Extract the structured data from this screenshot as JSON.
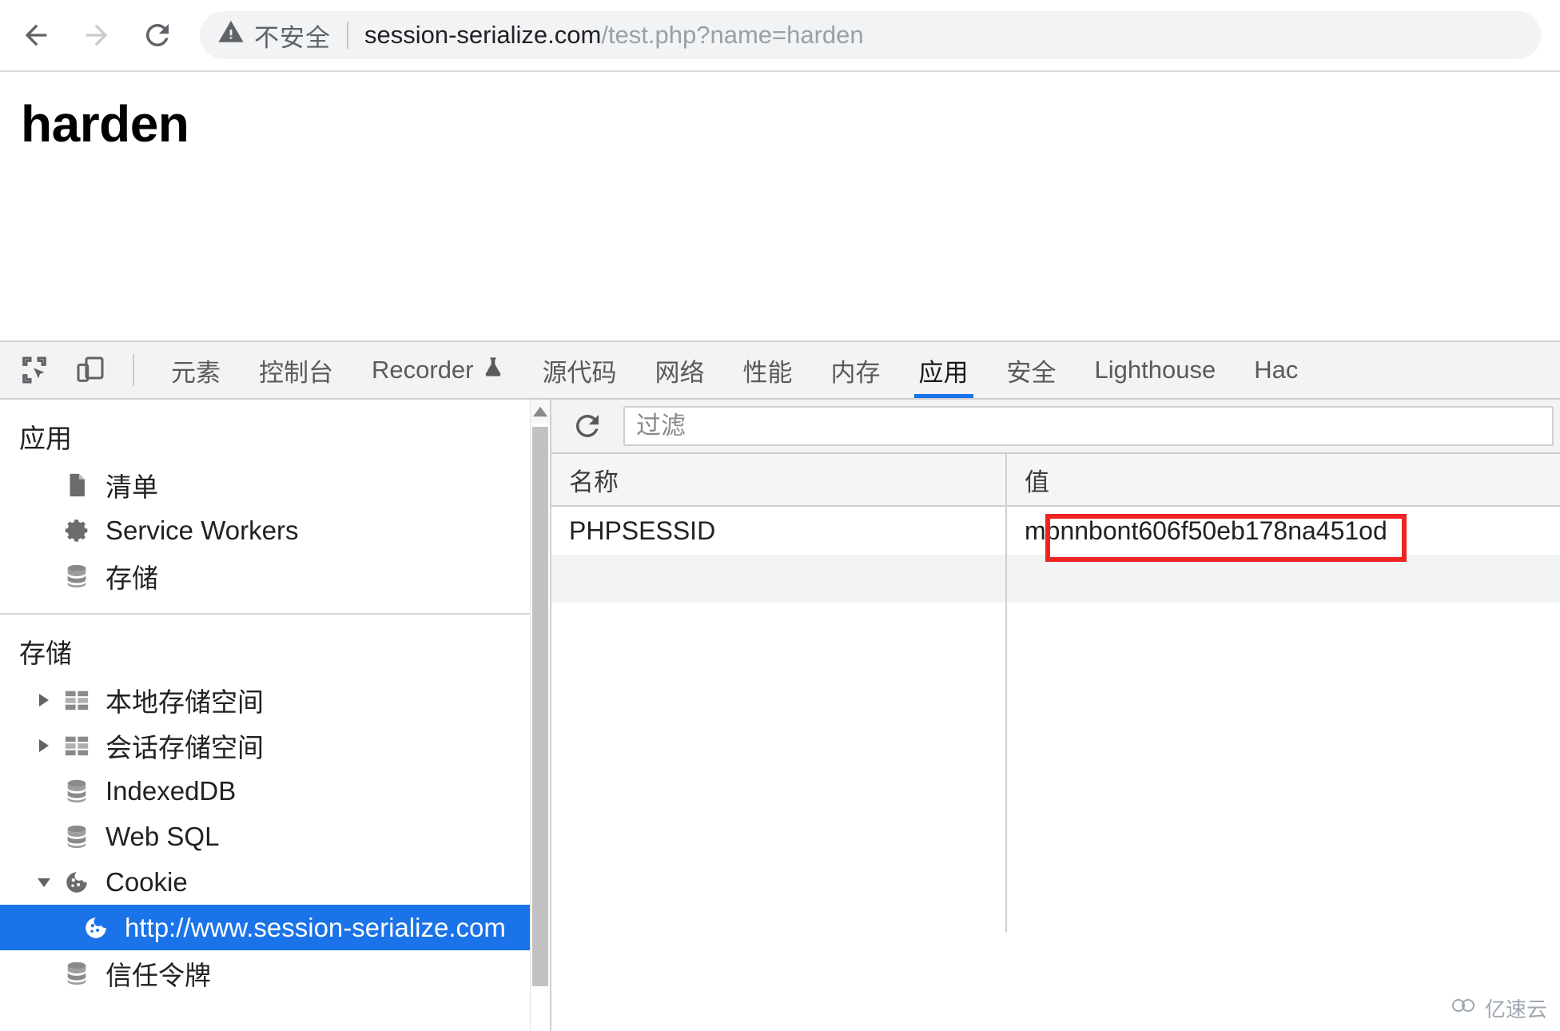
{
  "browser": {
    "back_label": "back-arrow",
    "forward_label": "forward-arrow",
    "reload_label": "reload",
    "security_text": "不安全",
    "url_host": "session-serialize.com",
    "url_path": "/test.php?name=harden"
  },
  "page": {
    "heading": "harden"
  },
  "devtools": {
    "toolbar_icons": [
      {
        "name": "inspect-element-icon"
      },
      {
        "name": "device-toolbar-icon"
      }
    ],
    "tabs": [
      {
        "label": "元素",
        "active": false
      },
      {
        "label": "控制台",
        "active": false
      },
      {
        "label": "Recorder",
        "active": false,
        "icon": "flask-icon"
      },
      {
        "label": "源代码",
        "active": false
      },
      {
        "label": "网络",
        "active": false
      },
      {
        "label": "性能",
        "active": false
      },
      {
        "label": "内存",
        "active": false
      },
      {
        "label": "应用",
        "active": true
      },
      {
        "label": "安全",
        "active": false
      },
      {
        "label": "Lighthouse",
        "active": false
      },
      {
        "label": "Hac",
        "active": false
      }
    ],
    "sidebar": {
      "sections": [
        {
          "title": "应用",
          "items": [
            {
              "label": "清单",
              "icon": "document-icon",
              "twisty": "",
              "selected": false,
              "child": false
            },
            {
              "label": "Service Workers",
              "icon": "gear-icon",
              "twisty": "",
              "selected": false,
              "child": false
            },
            {
              "label": "存储",
              "icon": "database-icon",
              "twisty": "",
              "selected": false,
              "child": false
            }
          ]
        },
        {
          "title": "存储",
          "items": [
            {
              "label": "本地存储空间",
              "icon": "table-grid-icon",
              "twisty": "▶",
              "selected": false,
              "child": false
            },
            {
              "label": "会话存储空间",
              "icon": "table-grid-icon",
              "twisty": "▶",
              "selected": false,
              "child": false
            },
            {
              "label": "IndexedDB",
              "icon": "database-icon",
              "twisty": "",
              "selected": false,
              "child": false
            },
            {
              "label": "Web SQL",
              "icon": "database-icon",
              "twisty": "",
              "selected": false,
              "child": false
            },
            {
              "label": "Cookie",
              "icon": "cookie-icon",
              "twisty": "▼",
              "selected": false,
              "child": false
            },
            {
              "label": "http://www.session-serialize.com",
              "icon": "cookie-icon",
              "twisty": "",
              "selected": true,
              "child": true
            },
            {
              "label": "信任令牌",
              "icon": "database-icon",
              "twisty": "",
              "selected": false,
              "child": false
            }
          ]
        }
      ]
    },
    "panel": {
      "refresh_icon": "refresh-icon",
      "filter_placeholder": "过滤",
      "filter_value": "",
      "table": {
        "columns": [
          "名称",
          "值"
        ],
        "rows": [
          {
            "name": "PHPSESSID",
            "value": "mpnnbont606f50eb178na451od"
          },
          {
            "name": "",
            "value": ""
          }
        ]
      }
    }
  },
  "annotation": {
    "highlight_color": "#f02323",
    "highlight_target": "mpnnbont606f50eb178na451od"
  },
  "watermark": {
    "text": "亿速云"
  }
}
